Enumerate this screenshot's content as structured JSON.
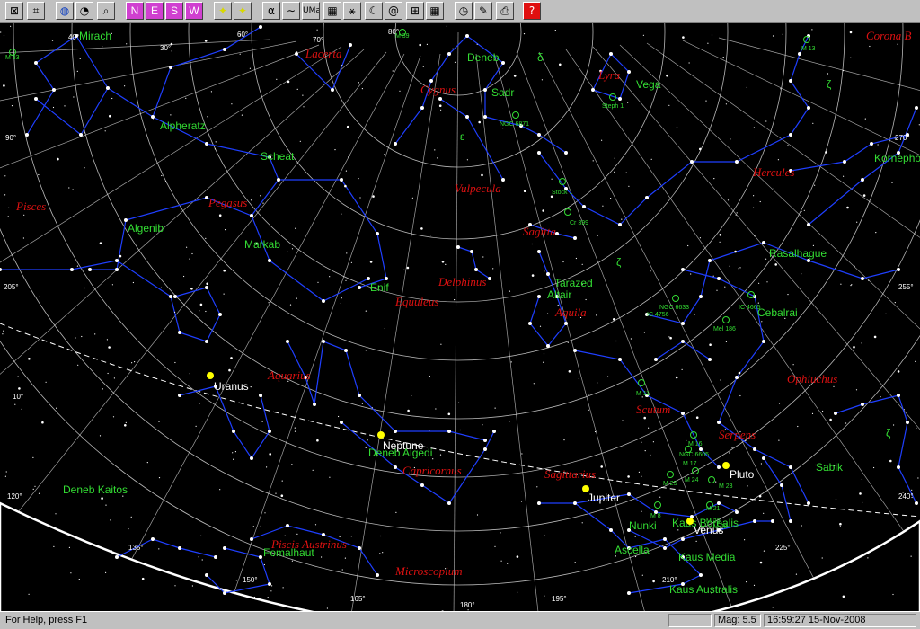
{
  "toolbar": {
    "buttons": [
      {
        "id": "zoom-fit",
        "glyph": "⊠"
      },
      {
        "id": "zoom-box",
        "glyph": "⌗"
      },
      {
        "id": "globe",
        "glyph": "◍"
      },
      {
        "id": "clock",
        "glyph": "◔"
      },
      {
        "id": "find",
        "glyph": "⌕"
      },
      {
        "id": "north",
        "glyph": "N"
      },
      {
        "id": "east",
        "glyph": "E"
      },
      {
        "id": "south",
        "glyph": "S"
      },
      {
        "id": "west",
        "glyph": "W"
      },
      {
        "id": "stars1",
        "glyph": "✦"
      },
      {
        "id": "stars2",
        "glyph": "✦"
      },
      {
        "id": "greek",
        "glyph": "α"
      },
      {
        "id": "milkyway",
        "glyph": "∼"
      },
      {
        "id": "const-abbr",
        "glyph": "UMa"
      },
      {
        "id": "const-boundary",
        "glyph": "▦"
      },
      {
        "id": "const-lines",
        "glyph": "⚹"
      },
      {
        "id": "moon",
        "glyph": "☾"
      },
      {
        "id": "galaxy",
        "glyph": "@"
      },
      {
        "id": "grid-radec",
        "glyph": "⊞"
      },
      {
        "id": "grid-altaz",
        "glyph": "▦"
      },
      {
        "id": "time",
        "glyph": "◷"
      },
      {
        "id": "pencil",
        "glyph": "✎"
      },
      {
        "id": "print",
        "glyph": "⎙"
      },
      {
        "id": "help",
        "glyph": "?"
      }
    ]
  },
  "status": {
    "help": "For Help, press F1",
    "mag": "Mag: 5.5",
    "datetime": "16:59:27 15-Nov-2008"
  },
  "colors": {
    "sky": "#000000",
    "constellation_lines": "#1f3fff",
    "grid": "#d8d8d8",
    "star_labels": "#33dd33",
    "constellation_names": "#dd1111",
    "planets": "#ffff00"
  },
  "grid_labels": [
    "40°",
    "30°",
    "60°",
    "70°",
    "80°",
    "90°",
    "270°",
    "205°",
    "255°",
    "10°",
    "120°",
    "240°",
    "135°",
    "150°",
    "165°",
    "180°",
    "195°",
    "210°",
    "225°"
  ],
  "star_labels": [
    "Mirach",
    "Alpheratz",
    "Scheat",
    "Algenib",
    "Markab",
    "Enif",
    "Deneb",
    "Sadr",
    "Vega",
    "Kornephoros",
    "Rasalhague",
    "Tarazed",
    "Altair",
    "Cebalrai",
    "Deneb Algedi",
    "Deneb Kaitos",
    "Fomalhaut",
    "Nunki",
    "Ascella",
    "Kaus Media",
    "Kaus Australis",
    "Kaus Borealis",
    "Sabik"
  ],
  "small_labels": [
    "M 33",
    "M 39",
    "M 13",
    "Stock 1",
    "Cr 399",
    "NGC 6871",
    "Steph 1",
    "NGC 6633",
    "IC 4756",
    "IC 4665",
    "Mel 186",
    "M 11",
    "M 16",
    "NGC 6605",
    "M 17",
    "M 24",
    "M 25",
    "M 23",
    "M 8",
    "M 21",
    "M 20",
    "M 28"
  ],
  "greek_labels": [
    "δ",
    "ζ",
    "ε",
    "ζ",
    "ζ"
  ],
  "constellations": [
    "Lacerta",
    "Cygnus",
    "Lyra",
    "Corona B",
    "Pisces",
    "Pegasus",
    "Vulpecula",
    "Hercules",
    "Sagitta",
    "Delphinus",
    "Equuleus",
    "Aquila",
    "Ophiuchus",
    "Aquarius",
    "Scutum",
    "Serpens",
    "Capricornus",
    "Sagittarius",
    "Piscis Austrinus",
    "Microscopium"
  ],
  "planets": [
    "Uranus",
    "Neptune",
    "Jupiter",
    "Venus",
    "Pluto"
  ]
}
